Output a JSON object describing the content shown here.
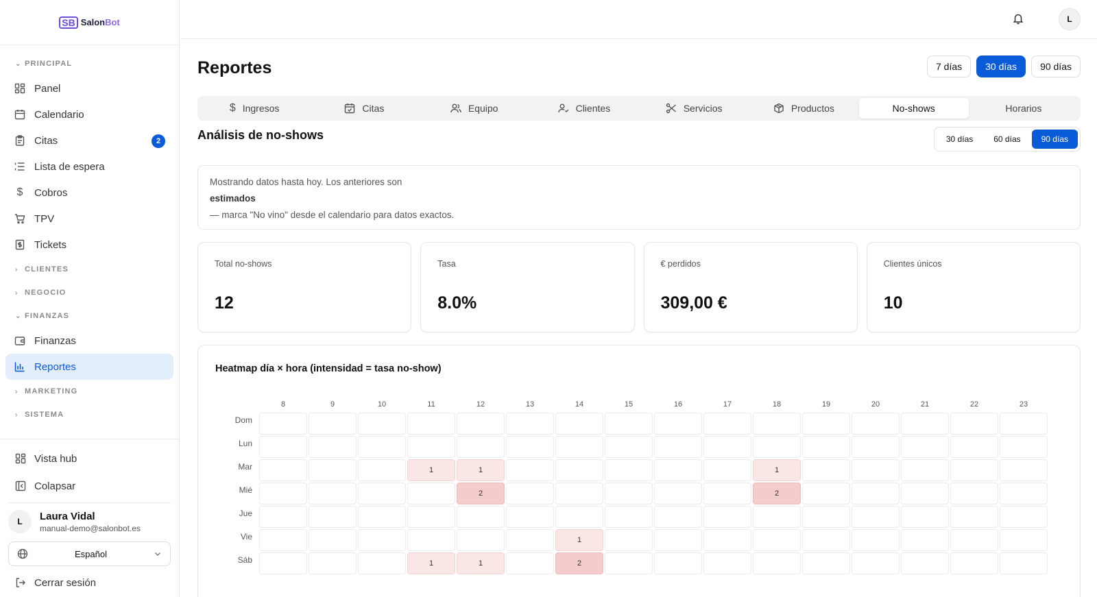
{
  "brand": {
    "mark": "SB",
    "name_prefix": "Salon",
    "name_suffix": "Bot"
  },
  "sidebar": {
    "section_principal": "PRINCIPAL",
    "items": [
      {
        "label": "Panel",
        "icon": "grid-icon"
      },
      {
        "label": "Calendario",
        "icon": "calendar-icon"
      },
      {
        "label": "Citas",
        "icon": "clipboard-icon",
        "badge": "2"
      },
      {
        "label": "Lista de espera",
        "icon": "list-icon"
      },
      {
        "label": "Cobros",
        "icon": "dollar-icon"
      },
      {
        "label": "TPV",
        "icon": "cart-icon"
      },
      {
        "label": "Tickets",
        "icon": "receipt-icon"
      }
    ],
    "section_clientes": "CLIENTES",
    "section_negocio": "NEGOCIO",
    "section_finanzas": "FINANZAS",
    "finanzas_items": [
      {
        "label": "Finanzas",
        "icon": "wallet-icon"
      },
      {
        "label": "Reportes",
        "icon": "bar-chart-icon"
      }
    ],
    "section_marketing": "MARKETING",
    "section_sistema": "SISTEMA",
    "vista_hub": "Vista hub",
    "colapsar": "Colapsar",
    "user_name": "Laura Vidal",
    "user_email": "manual-demo@salonbot.es",
    "user_initial": "L",
    "language": "Español",
    "logout": "Cerrar sesión"
  },
  "topbar": {
    "avatar_initial": "L"
  },
  "page": {
    "title": "Reportes",
    "ranges": [
      "7 días",
      "30 días",
      "90 días"
    ],
    "selected_range": "30 días",
    "tabs": [
      {
        "label": "Ingresos",
        "icon": "dollar-icon"
      },
      {
        "label": "Citas",
        "icon": "calendar-check-icon"
      },
      {
        "label": "Equipo",
        "icon": "users-icon"
      },
      {
        "label": "Clientes",
        "icon": "user-check-icon"
      },
      {
        "label": "Servicios",
        "icon": "scissors-icon"
      },
      {
        "label": "Productos",
        "icon": "box-icon"
      },
      {
        "label": "No-shows",
        "icon": ""
      },
      {
        "label": "Horarios",
        "icon": ""
      }
    ],
    "active_tab": "No-shows",
    "section_title": "Análisis de no-shows",
    "sub_ranges": [
      "30 días",
      "60 días",
      "90 días"
    ],
    "selected_sub_range": "90 días",
    "note_line1": "Mostrando datos hasta hoy. Los anteriores son",
    "note_bold": "estimados",
    "note_line3": "— marca \"No vino\" desde el calendario para datos exactos.",
    "kpis": [
      {
        "label": "Total no-shows",
        "value": "12"
      },
      {
        "label": "Tasa",
        "value": "8.0%"
      },
      {
        "label": "€ perdidos",
        "value": "309,00 €"
      },
      {
        "label": "Clientes únicos",
        "value": "10"
      }
    ],
    "heatmap_title": "Heatmap día × hora (intensidad = tasa no-show)"
  },
  "chart_data": {
    "type": "heatmap",
    "title": "Heatmap día × hora (intensidad = tasa no-show)",
    "x": [
      "8",
      "9",
      "10",
      "11",
      "12",
      "13",
      "14",
      "15",
      "16",
      "17",
      "18",
      "19",
      "20",
      "21",
      "22",
      "23"
    ],
    "y": [
      "Dom",
      "Lun",
      "Mar",
      "Mié",
      "Jue",
      "Vie",
      "Sáb"
    ],
    "values": [
      [
        0,
        0,
        0,
        0,
        0,
        0,
        0,
        0,
        0,
        0,
        0,
        0,
        0,
        0,
        0,
        0
      ],
      [
        0,
        0,
        0,
        0,
        0,
        0,
        0,
        0,
        0,
        0,
        0,
        0,
        0,
        0,
        0,
        0
      ],
      [
        0,
        0,
        0,
        1,
        1,
        0,
        0,
        0,
        0,
        0,
        1,
        0,
        0,
        0,
        0,
        0
      ],
      [
        0,
        0,
        0,
        0,
        2,
        0,
        0,
        0,
        0,
        0,
        2,
        0,
        0,
        0,
        0,
        0
      ],
      [
        0,
        0,
        0,
        0,
        0,
        0,
        0,
        0,
        0,
        0,
        0,
        0,
        0,
        0,
        0,
        0
      ],
      [
        0,
        0,
        0,
        0,
        0,
        0,
        1,
        0,
        0,
        0,
        0,
        0,
        0,
        0,
        0,
        0
      ],
      [
        0,
        0,
        0,
        1,
        1,
        0,
        2,
        0,
        0,
        0,
        0,
        0,
        0,
        0,
        0,
        0
      ]
    ],
    "colors": {
      "low": "#fbe6e6",
      "high": "#f5cccc",
      "empty": "#ffffff"
    }
  },
  "colors": {
    "accent": "#0a5bd8",
    "active_bg": "#e3eefc"
  }
}
